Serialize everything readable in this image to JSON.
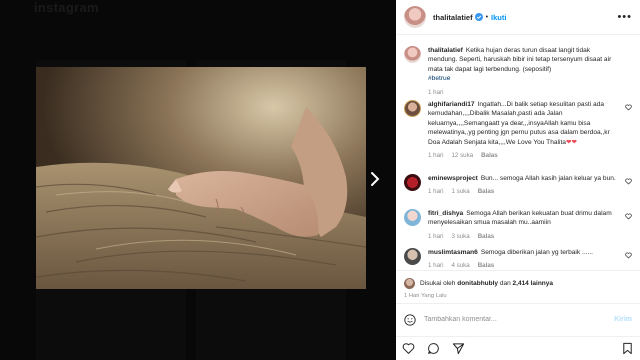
{
  "background": {
    "title": "instagram"
  },
  "post": {
    "username": "thalitalatief",
    "follow_label": "Ikuti",
    "dot": "•",
    "more": "•••",
    "caption_user": "thalitalatief",
    "caption_text": "Ketika hujan deras turun disaat langit tidak mendung. Seperti, haruskah bibir ini tetap tersenyum disaat air mata tak dapat lagi terbendung. (sepositif)",
    "caption_tag": "#betrue",
    "caption_time": "1 hari"
  },
  "comments": [
    {
      "user": "alghifariandi17",
      "text": "Ingatlah...Di balik setiap kesulitan pasti ada kemudahan,,,,Dibalik Masalah,pasti ada Jalan keluarnya,,,,Semangaatt ya dear,,,insyaAllah kamu bisa melewatinya,,yg penting jgn pernu putus asa dalam berdoa,,kr Doa Adalah Senjata kita,,,,We Love You Thalita",
      "hearts": "❤❤",
      "time": "1 hari",
      "likes": "12 suka",
      "reply": "Balas"
    },
    {
      "user": "eminewsproject",
      "text": "Bun... semoga Allah kasih jalan keluar ya bun.",
      "time": "1 hari",
      "likes": "1 suka",
      "reply": "Balas"
    },
    {
      "user": "fitri_dishya",
      "text": "Semoga Allah berikan kekuatan buat drimu dalam menyelesaikan smua masalah mu..aamiin",
      "time": "1 hari",
      "likes": "3 suka",
      "reply": "Balas"
    },
    {
      "user": "muslimtasman6",
      "text": "Semoga diberikan jalan yg terbaik ......",
      "time": "1 hari",
      "likes": "4 suka",
      "reply": "Balas"
    }
  ],
  "likes": {
    "prefix": "Disukai oleh",
    "user": "donitabhubly",
    "connector": "dan",
    "others": "2,414 lainnya"
  },
  "date": "1 Hari Yang Lalu",
  "comment_box": {
    "placeholder": "Tambahkan komentar...",
    "post_label": "Kirim"
  },
  "colors": {
    "accent": "#0095f6",
    "post_disabled": "#b2dffc",
    "heart": "#ed4956"
  }
}
